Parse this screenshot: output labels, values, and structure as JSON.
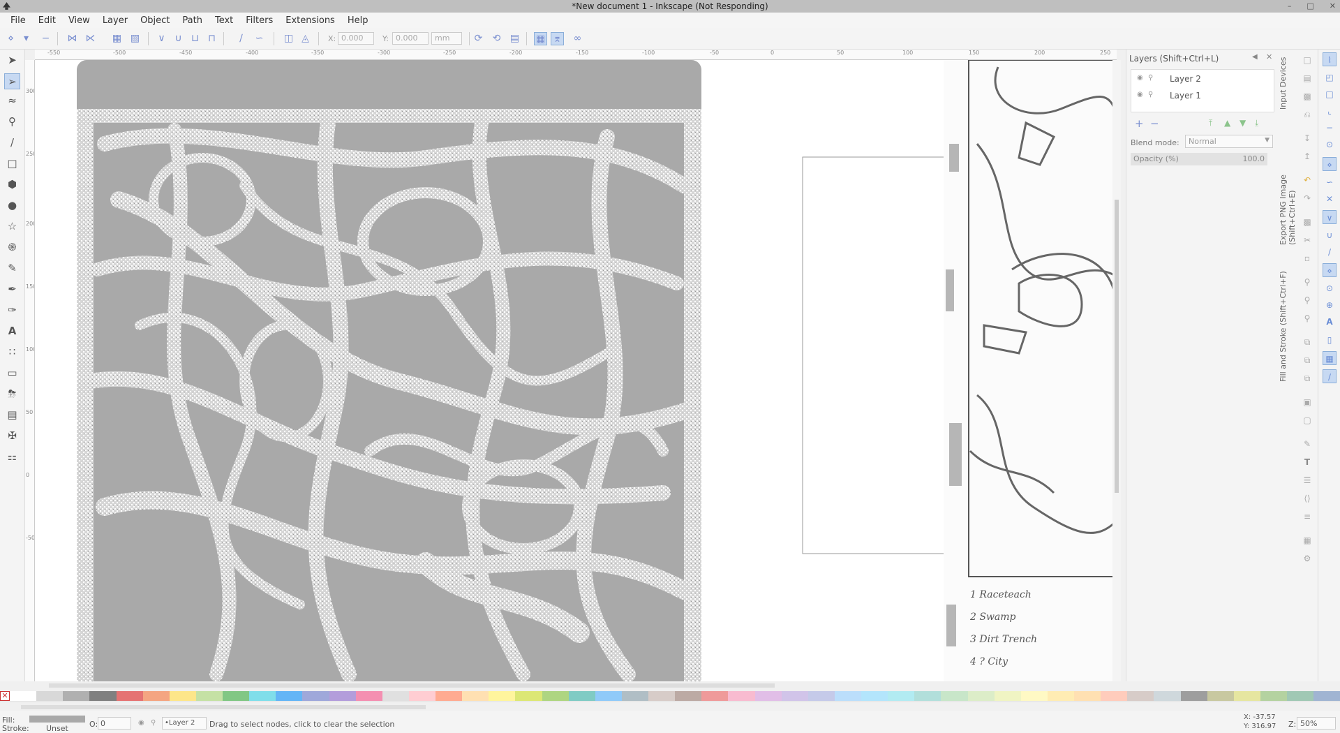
{
  "window": {
    "title": "*New document 1 - Inkscape (Not Responding)",
    "controls": [
      "–",
      "□",
      "✕"
    ]
  },
  "menu": [
    "File",
    "Edit",
    "View",
    "Layer",
    "Object",
    "Path",
    "Text",
    "Filters",
    "Extensions",
    "Help"
  ],
  "tool_controls": {
    "x_label": "X:",
    "x_value": "0.000",
    "y_label": "Y:",
    "y_value": "0.000",
    "unit": "mm"
  },
  "ruler": {
    "h_ticks": [
      "-550",
      "-500",
      "-450",
      "-400",
      "-350",
      "-300",
      "-250",
      "-200",
      "-150",
      "-100",
      "-50",
      "0",
      "50",
      "100",
      "150",
      "200",
      "250"
    ],
    "v_ticks": [
      "300",
      "250",
      "200",
      "150",
      "100",
      "50",
      "0",
      "-50"
    ]
  },
  "layers_panel": {
    "title": "Layers (Shift+Ctrl+L)",
    "layers": [
      "Layer 2",
      "Layer 1"
    ],
    "blend_label": "Blend mode:",
    "blend_value": "Normal",
    "opacity_label": "Opacity (%)",
    "opacity_value": "100.0"
  },
  "side_tabs": {
    "input_devices": "Input Devices",
    "export": "Export PNG Image (Shift+Ctrl+E)",
    "fill_stroke": "Fill and Stroke (Shift+Ctrl+F)"
  },
  "map_legend": [
    "1 Raceteach",
    "2 Swamp",
    "3 Dirt Trench",
    "4 ? City"
  ],
  "status": {
    "fill_label": "Fill:",
    "stroke_label": "Stroke:",
    "stroke_value": "Unset",
    "opacity_label": "O:",
    "opacity_value": "0",
    "layer_value": "•Layer 2",
    "message": "Drag to select nodes, click to clear the selection",
    "x_coord": "X: -37.57",
    "y_coord": "Y: 316.97",
    "zoom_label": "Z:",
    "zoom_value": "50%"
  },
  "colors": {
    "canvas_gray": "#a9a9a9",
    "accent": "#c7d9f2"
  },
  "palette": [
    "#ffffff",
    "#d8d8d8",
    "#b0b0b0",
    "#808080",
    "#e57373",
    "#f4a582",
    "#fde68a",
    "#c5e1a5",
    "#81c784",
    "#80deea",
    "#64b5f6",
    "#9fa8da",
    "#b39ddb",
    "#f48fb1",
    "#e0e0e0",
    "#ffcdd2",
    "#ffab91",
    "#ffe0b2",
    "#fff59d",
    "#dce775",
    "#aed581",
    "#80cbc4",
    "#90caf9",
    "#b0bec5",
    "#d7ccc8",
    "#bcaaa4",
    "#ef9a9a",
    "#f8bbd0",
    "#e1bee7",
    "#d1c4e9",
    "#c5cae9",
    "#bbdefb",
    "#b3e5fc",
    "#b2ebf2",
    "#b2dfdb",
    "#c8e6c9",
    "#dcedc8",
    "#f0f4c3",
    "#fff9c4",
    "#ffecb3",
    "#ffe0b2",
    "#ffccbc",
    "#d7ccc8",
    "#cfd8dc",
    "#9e9e9e",
    "#c8c8a0",
    "#e6e6a0",
    "#b4d2a0",
    "#a0c8b4",
    "#a0b4d2"
  ]
}
